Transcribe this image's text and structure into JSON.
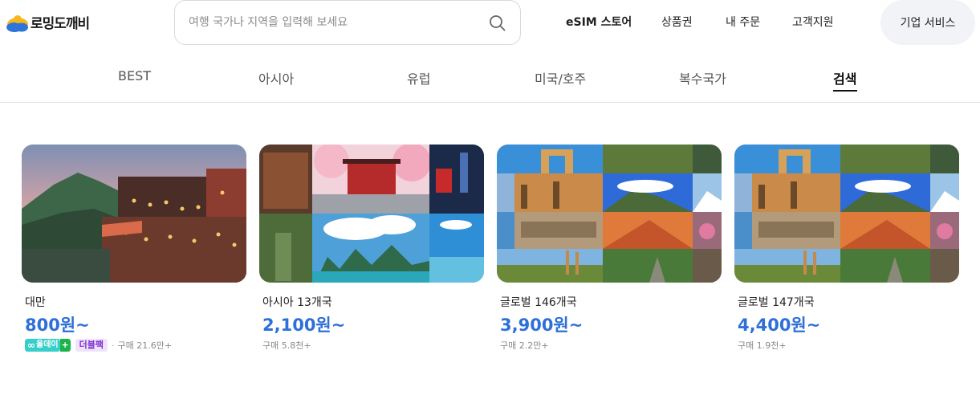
{
  "header": {
    "logo_text": "로밍도깨비",
    "search": {
      "placeholder": "여행 국가나 지역을 입력해 보세요",
      "value": ""
    },
    "nav": [
      {
        "label": "eSIM 스토어",
        "bold": true
      },
      {
        "label": "상품권",
        "bold": false
      },
      {
        "label": "내 주문",
        "bold": false
      },
      {
        "label": "고객지원",
        "bold": false
      }
    ],
    "business_button": "기업 서비스"
  },
  "tabs": [
    {
      "label": "BEST",
      "active": false
    },
    {
      "label": "아시아",
      "active": false
    },
    {
      "label": "유럽",
      "active": false
    },
    {
      "label": "미국/호주",
      "active": false
    },
    {
      "label": "복수국가",
      "active": false
    },
    {
      "label": "검색",
      "active": true
    }
  ],
  "cards": [
    {
      "title": "대만",
      "price": "800원~",
      "badges": {
        "allday": "올데이",
        "allday_plus": "+",
        "double": "더블팩"
      },
      "sold": "구매 21.6만+"
    },
    {
      "title": "아시아 13개국",
      "price": "2,100원~",
      "sold": "구매 5.8천+"
    },
    {
      "title": "글로벌 146개국",
      "price": "3,900원~",
      "sold": "구매 2.2만+"
    },
    {
      "title": "글로벌 147개국",
      "price": "4,400원~",
      "sold": "구매 1.9천+"
    }
  ],
  "colors": {
    "price": "#2e6fd9",
    "allday_badge": "#36cfc9",
    "plus_badge": "#1db34b",
    "double_badge_text": "#7b2fd0",
    "double_badge_bg": "#f0e4fb"
  }
}
